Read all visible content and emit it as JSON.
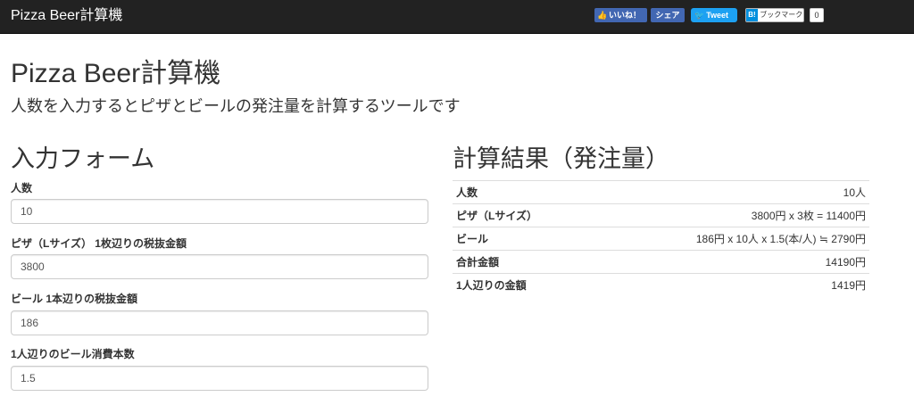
{
  "navbar": {
    "brand": "Pizza Beer計算機",
    "facebook_like": "いいね！",
    "facebook_share": "シェア",
    "tweet": "Tweet",
    "hatena_logo": "B!",
    "hatena_label": "ブックマーク",
    "hatena_count": "0"
  },
  "header": {
    "title": "Pizza Beer計算機",
    "subtitle": "人数を入力するとピザとビールの発注量を計算するツールです"
  },
  "form": {
    "title": "入力フォーム",
    "fields": [
      {
        "label": "人数",
        "value": "10"
      },
      {
        "label": "ピザ（Lサイズ） 1枚辺りの税抜金額",
        "value": "3800"
      },
      {
        "label": "ビール 1本辺りの税抜金額",
        "value": "186"
      },
      {
        "label": "1人辺りのビール消費本数",
        "value": "1.5"
      }
    ]
  },
  "result": {
    "title": "計算結果（発注量）",
    "rows": [
      {
        "label": "人数",
        "value": "10人"
      },
      {
        "label": "ピザ（Lサイズ）",
        "value": "3800円 x 3枚 = 11400円"
      },
      {
        "label": "ビール",
        "value": "186円 x 10人 x 1.5(本/人) ≒ 2790円"
      },
      {
        "label": "合計金額",
        "value": "14190円"
      },
      {
        "label": "1人辺りの金額",
        "value": "1419円"
      }
    ]
  },
  "colors": {
    "navbar_bg": "#222222",
    "facebook": "#4267b2",
    "twitter": "#1da1f2",
    "hatena": "#008fde"
  }
}
